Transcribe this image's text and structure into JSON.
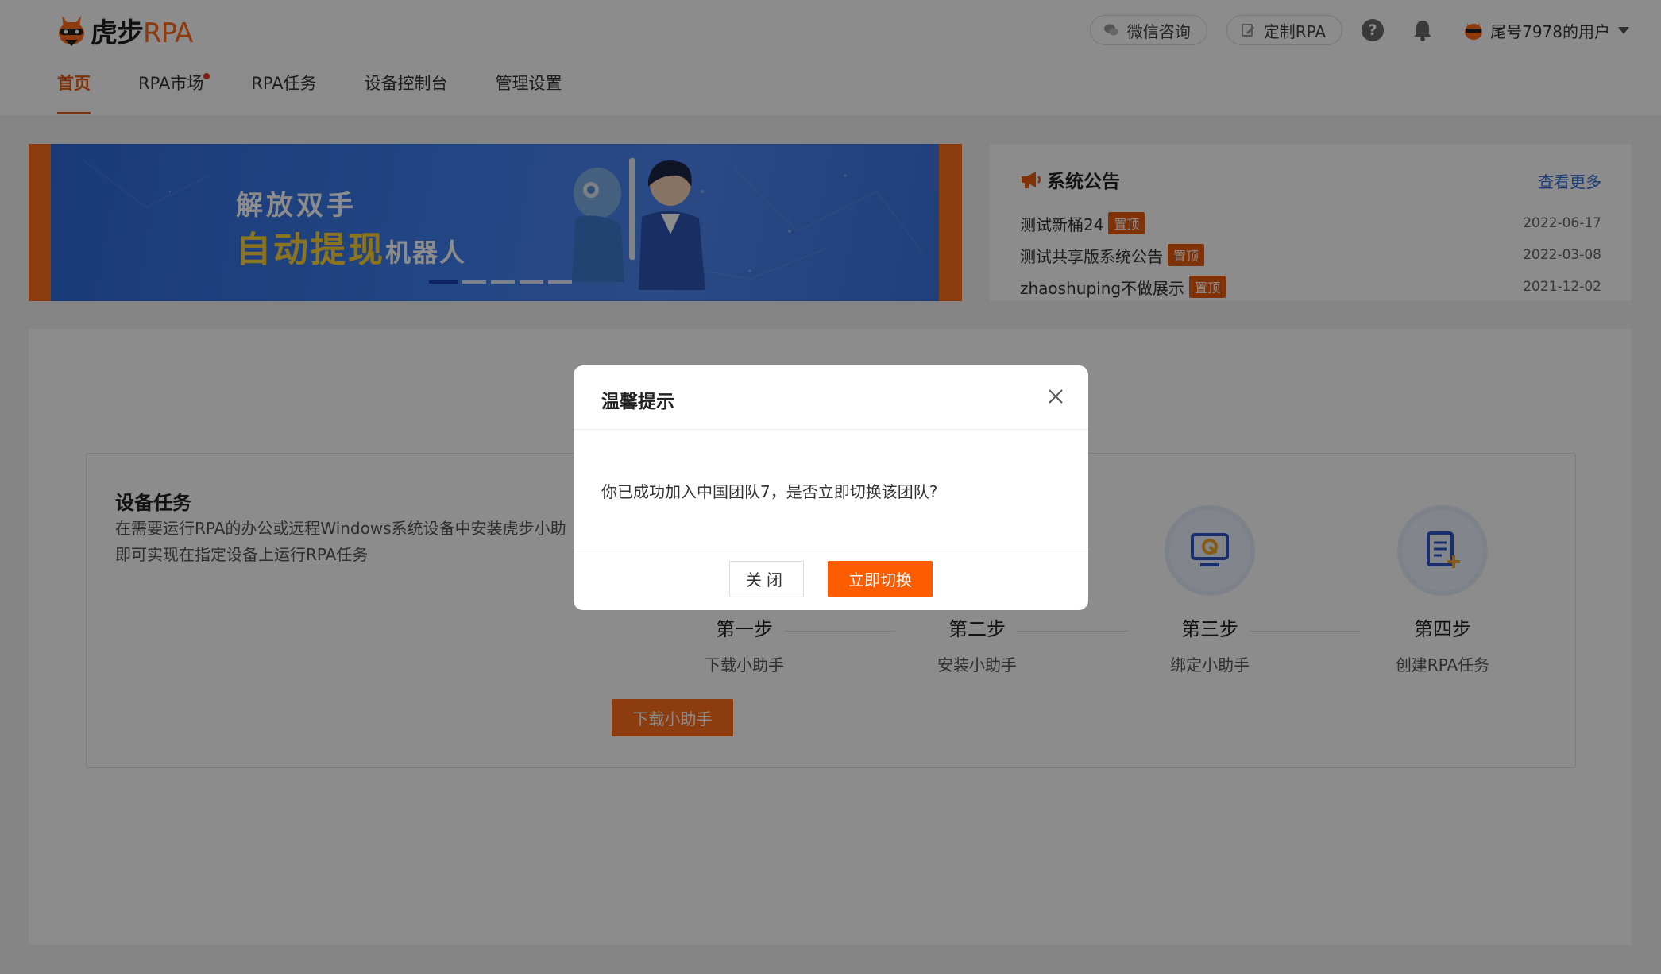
{
  "brand": {
    "name_cn": "虎步",
    "name_en": "RPA"
  },
  "nav": {
    "items": [
      {
        "label": "首页",
        "active": true
      },
      {
        "label": "RPA市场",
        "badge_dot": true
      },
      {
        "label": "RPA任务"
      },
      {
        "label": "设备控制台"
      },
      {
        "label": "管理设置"
      }
    ]
  },
  "header": {
    "wechat_label": "微信咨询",
    "custom_label": "定制RPA",
    "help_glyph": "?",
    "user_name": "尾号7978的用户"
  },
  "banner": {
    "line1": "解放双手",
    "line2_highlight": "自动提现",
    "line2_rest": "机器人",
    "slides": 5,
    "active_slide": 1
  },
  "notice": {
    "title": "系统公告",
    "more": "查看更多",
    "items": [
      {
        "title": "测试新桶24",
        "tag": "置顶",
        "date": "2022-06-17"
      },
      {
        "title": "测试共享版系统公告",
        "tag": "置顶",
        "date": "2022-03-08"
      },
      {
        "title": "zhaoshuping不做展示",
        "tag": "置顶",
        "date": "2021-12-02"
      }
    ]
  },
  "device": {
    "title": "设备任务",
    "desc_line1": "在需要运行RPA的办公或远程Windows系统设备中安装虎步小助",
    "desc_line2": "即可实现在指定设备上运行RPA任务",
    "steps": [
      {
        "name": "第一步",
        "sub": "下载小助手"
      },
      {
        "name": "第二步",
        "sub": "安装小助手"
      },
      {
        "name": "第三步",
        "sub": "绑定小助手"
      },
      {
        "name": "第四步",
        "sub": "创建RPA任务"
      }
    ],
    "download_label": "下载小助手"
  },
  "modal": {
    "title": "温馨提示",
    "message": "你已成功加入中国团队7，是否立即切换该团队?",
    "close_label": "关闭",
    "confirm_label": "立即切换"
  },
  "colors": {
    "accent": "#ff6d1a",
    "link": "#2f6bd8",
    "step_icon": "#2f55c8"
  }
}
